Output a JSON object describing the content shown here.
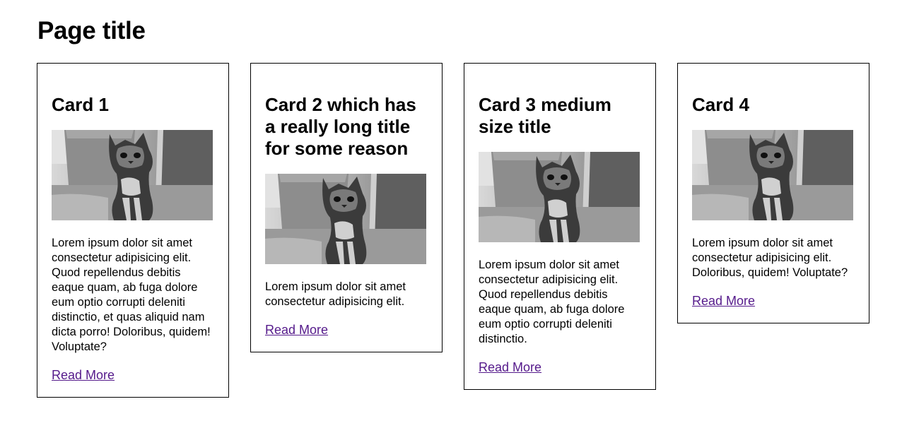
{
  "page": {
    "title": "Page title"
  },
  "cards": [
    {
      "title": "Card 1",
      "image_alt": "kitten",
      "text": "Lorem ipsum dolor sit amet consectetur adipisicing elit. Quod repellendus debitis eaque quam, ab fuga dolore eum optio corrupti deleniti distinctio, et quas aliquid nam dicta porro! Doloribus, quidem! Voluptate?",
      "link": "Read More"
    },
    {
      "title": "Card 2 which has a really long title for some reason",
      "image_alt": "kitten",
      "text": "Lorem ipsum dolor sit amet consectetur adipisicing elit.",
      "link": "Read More"
    },
    {
      "title": "Card 3 medium size title",
      "image_alt": "kitten",
      "text": "Lorem ipsum dolor sit amet consectetur adipisicing elit. Quod repellendus debitis eaque quam, ab fuga dolore eum optio corrupti deleniti distinctio.",
      "link": "Read More"
    },
    {
      "title": "Card 4",
      "image_alt": "kitten",
      "text": "Lorem ipsum dolor sit amet consectetur adipisicing elit. Doloribus, quidem! Voluptate?",
      "link": "Read More"
    }
  ],
  "colors": {
    "link": "#551a8b",
    "border": "#000000"
  }
}
